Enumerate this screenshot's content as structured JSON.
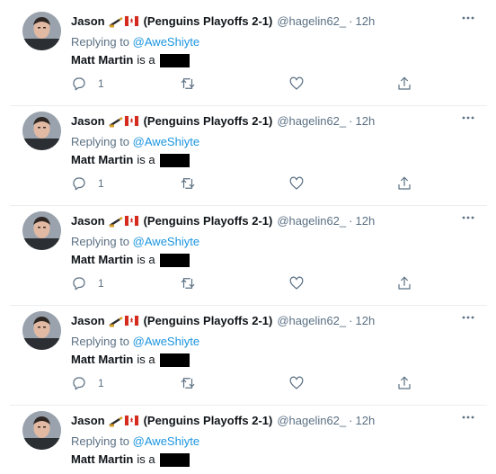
{
  "tweets": [
    {
      "name": "Jason",
      "team": "(Penguins Playoffs 2-1)",
      "handle": "@hagelin62_",
      "dot": "·",
      "time": "12h",
      "replying_prefix": "Replying to",
      "replying_to": "@AweShiyte",
      "mention_name": "Matt Martin",
      "body_text": "is a",
      "reply_count": "1"
    },
    {
      "name": "Jason",
      "team": "(Penguins Playoffs 2-1)",
      "handle": "@hagelin62_",
      "dot": "·",
      "time": "12h",
      "replying_prefix": "Replying to",
      "replying_to": "@AweShiyte",
      "mention_name": "Matt Martin",
      "body_text": "is a",
      "reply_count": "1"
    },
    {
      "name": "Jason",
      "team": "(Penguins Playoffs 2-1)",
      "handle": "@hagelin62_",
      "dot": "·",
      "time": "12h",
      "replying_prefix": "Replying to",
      "replying_to": "@AweShiyte",
      "mention_name": "Matt Martin",
      "body_text": "is a",
      "reply_count": "1"
    },
    {
      "name": "Jason",
      "team": "(Penguins Playoffs 2-1)",
      "handle": "@hagelin62_",
      "dot": "·",
      "time": "12h",
      "replying_prefix": "Replying to",
      "replying_to": "@AweShiyte",
      "mention_name": "Matt Martin",
      "body_text": "is a",
      "reply_count": "1"
    },
    {
      "name": "Jason",
      "team": "(Penguins Playoffs 2-1)",
      "handle": "@hagelin62_",
      "dot": "·",
      "time": "12h",
      "replying_prefix": "Replying to",
      "replying_to": "@AweShiyte",
      "mention_name": "Matt Martin",
      "body_text": "is a",
      "reply_count": ""
    }
  ],
  "icons": {
    "more": "more-horizontal-icon",
    "reply": "reply-icon",
    "retweet": "retweet-icon",
    "like": "like-heart-icon",
    "share": "share-icon",
    "emoji_1": "hockey-stick-emoji",
    "emoji_2": "canada-flag-emoji"
  },
  "colors": {
    "text_primary": "#0f1419",
    "text_secondary": "#5b7083",
    "link": "#1b95e0",
    "divider": "#ebeef0"
  }
}
